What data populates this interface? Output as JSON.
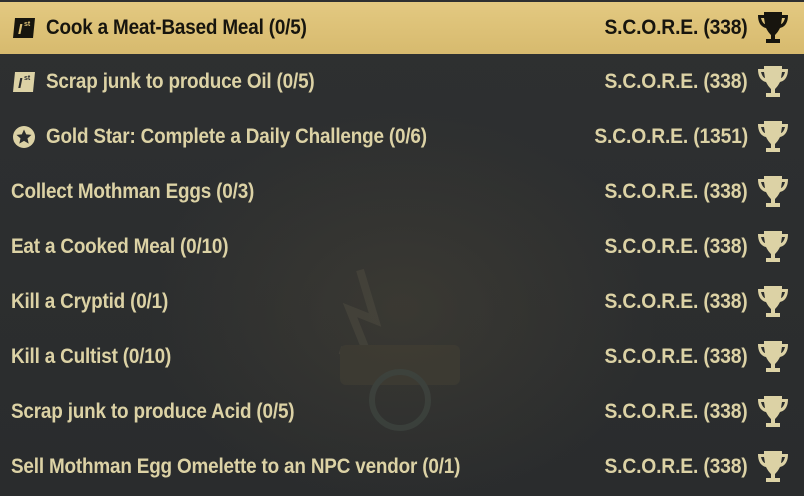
{
  "colors": {
    "row_text": "#dcd2a5",
    "selected_bg": "#dcc076",
    "selected_text": "#17150e",
    "panel_bg": "#2b2d2e"
  },
  "challenges": [
    {
      "label": "Cook a Meat-Based Meal (0/5)",
      "score": "S.C.O.R.E. (338)",
      "icon": "first-daily-icon",
      "selected": true
    },
    {
      "label": "Scrap junk to produce Oil (0/5)",
      "score": "S.C.O.R.E. (338)",
      "icon": "first-daily-icon",
      "selected": false
    },
    {
      "label": "Gold Star: Complete a Daily Challenge (0/6)",
      "score": "S.C.O.R.E. (1351)",
      "icon": "gold-star-icon",
      "selected": false
    },
    {
      "label": "Collect Mothman Eggs (0/3)",
      "score": "S.C.O.R.E. (338)",
      "icon": "",
      "selected": false
    },
    {
      "label": "Eat a Cooked Meal (0/10)",
      "score": "S.C.O.R.E. (338)",
      "icon": "",
      "selected": false
    },
    {
      "label": "Kill a Cryptid (0/1)",
      "score": "S.C.O.R.E. (338)",
      "icon": "",
      "selected": false
    },
    {
      "label": "Kill a Cultist (0/10)",
      "score": "S.C.O.R.E. (338)",
      "icon": "",
      "selected": false
    },
    {
      "label": "Scrap junk to produce Acid (0/5)",
      "score": "S.C.O.R.E. (338)",
      "icon": "",
      "selected": false
    },
    {
      "label": "Sell Mothman Egg Omelette to an NPC vendor (0/1)",
      "score": "S.C.O.R.E. (338)",
      "icon": "",
      "selected": false
    }
  ]
}
